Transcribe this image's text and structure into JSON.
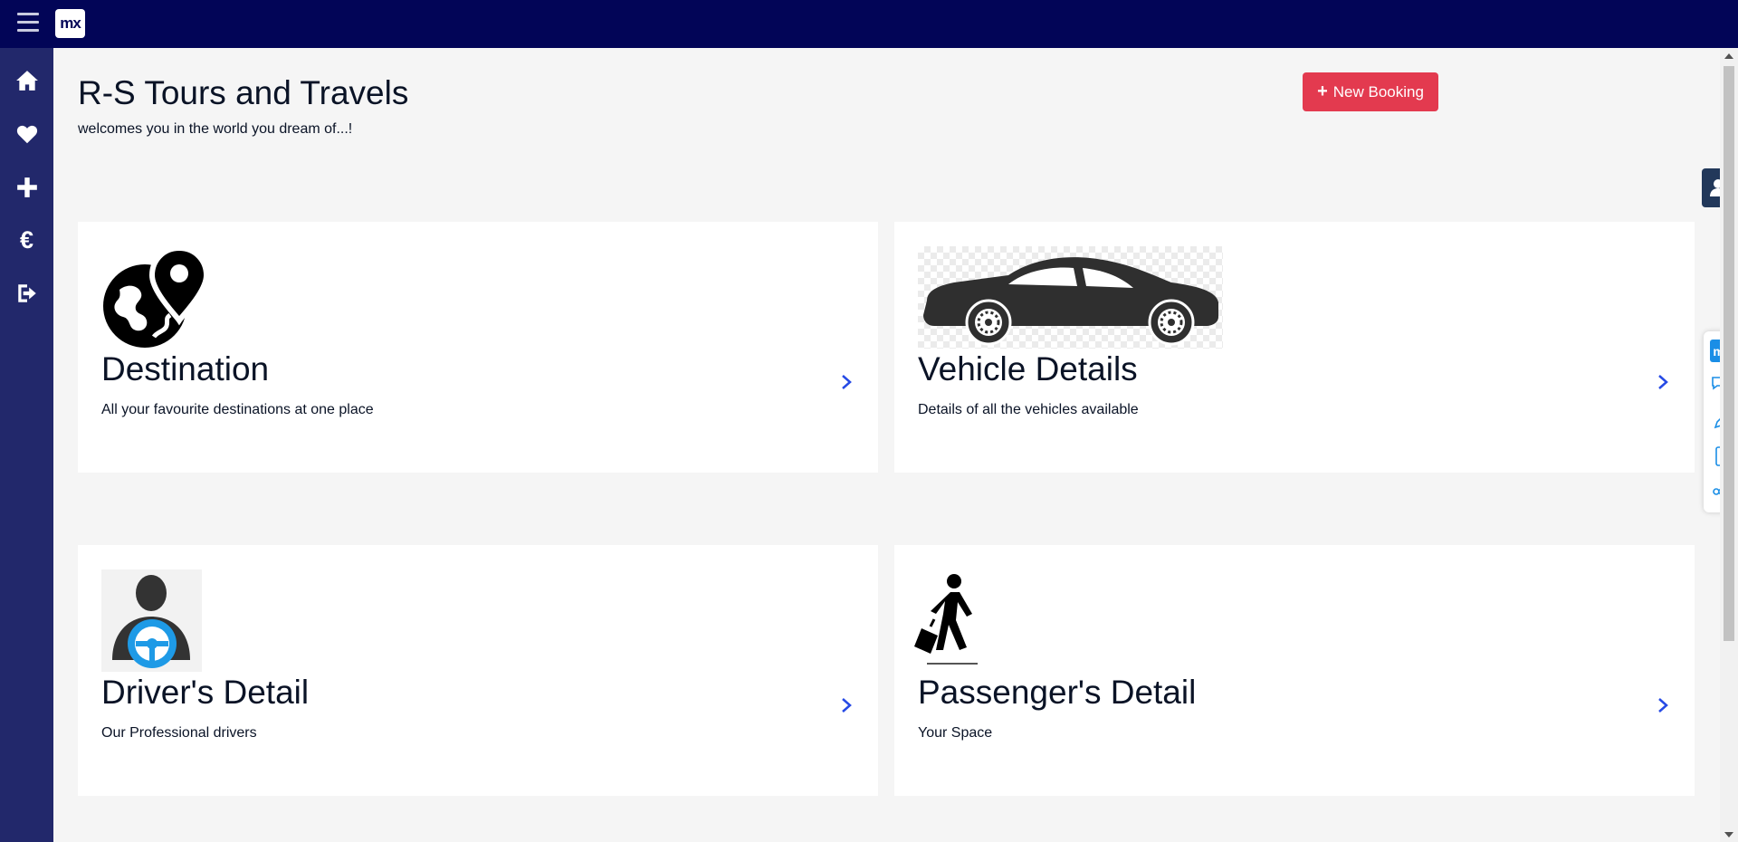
{
  "header": {
    "logo_text": "mx"
  },
  "sidebar": {
    "items": [
      {
        "name": "home",
        "icon": "home-icon"
      },
      {
        "name": "favourites",
        "icon": "heart-icon"
      },
      {
        "name": "add",
        "icon": "plus-icon"
      },
      {
        "name": "payments",
        "icon": "euro-icon",
        "glyph": "€"
      },
      {
        "name": "sign-out",
        "icon": "sign-out-icon"
      }
    ]
  },
  "page": {
    "title": "R-S Tours and Travels",
    "subtitle": "welcomes you in the world you dream of...!",
    "new_booking_label": "New Booking"
  },
  "cards": [
    {
      "title": "Destination",
      "description": "All your favourite destinations at one place",
      "icon": "globe-location-icon"
    },
    {
      "title": "Vehicle Details",
      "description": "Details of all the vehicles available",
      "icon": "car-icon"
    },
    {
      "title": "Driver's Detail",
      "description": "Our Professional drivers",
      "icon": "driver-icon"
    },
    {
      "title": "Passenger's Detail",
      "description": "Your Space",
      "icon": "passenger-icon"
    }
  ],
  "mx_toolbar": {
    "badge": "mx",
    "tools": [
      "mx-logo-icon",
      "chat-icon",
      "pencil-icon",
      "mobile-icon",
      "share-icon"
    ]
  },
  "colors": {
    "topbar": "#020557",
    "sidebar": "#22286b",
    "accent_button": "#e33a4f",
    "chevron": "#264ae5",
    "background": "#f5f5f5"
  }
}
